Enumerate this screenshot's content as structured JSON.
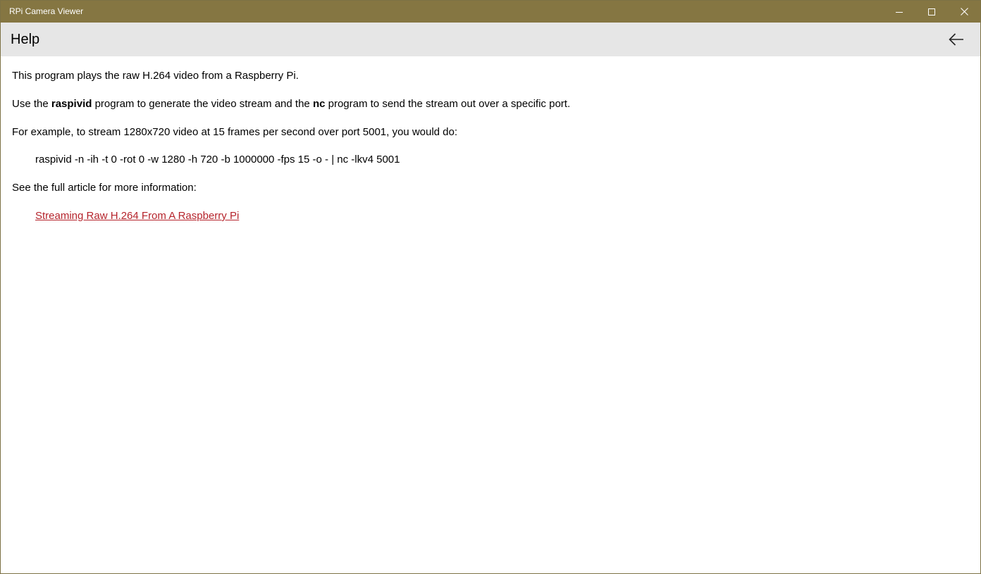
{
  "window": {
    "title": "RPi Camera Viewer",
    "accent_color": "#857642",
    "controls": {
      "minimize_icon": "minimize-icon",
      "maximize_icon": "maximize-icon",
      "close_icon": "close-icon"
    }
  },
  "header": {
    "title": "Help",
    "back_icon": "back-arrow-icon"
  },
  "help": {
    "intro": "This program plays the raw H.264 video from a Raspberry Pi.",
    "usage_prefix": "Use the ",
    "usage_raspivid": "raspivid",
    "usage_middle": " program to generate the video stream and the ",
    "usage_nc": "nc",
    "usage_suffix": " program to send the stream out over a specific port.",
    "example_intro": "For example, to stream 1280x720 video at 15 frames per second over port 5001, you would do:",
    "example_command": "raspivid -n -ih -t 0 -rot 0 -w 1280 -h 720 -b 1000000 -fps 15 -o - | nc -lkv4 5001",
    "article_intro": "See the full article for more information:",
    "article_link_text": "Streaming Raw H.264 From A Raspberry Pi",
    "link_color": "#b5232b"
  }
}
